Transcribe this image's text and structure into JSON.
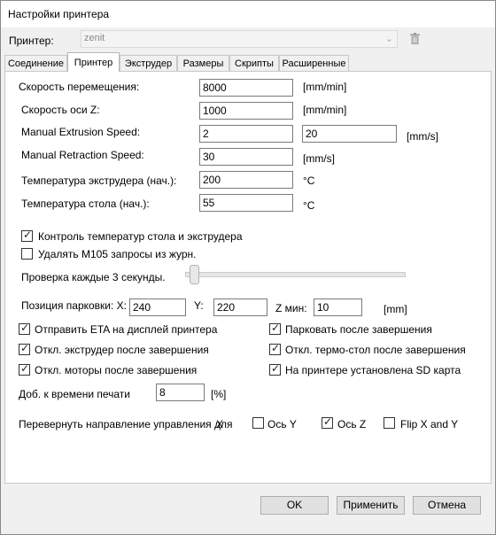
{
  "window": {
    "title": "Настройки принтера"
  },
  "printer": {
    "label": "Принтер:",
    "value": "zenit",
    "delete_icon": "trash-icon"
  },
  "tabs": [
    "Соединение",
    "Принтер",
    "Экструдер",
    "Размеры",
    "Скрипты",
    "Расширенные"
  ],
  "active_tab": "Принтер",
  "speed": {
    "travel_label": "Скорость перемещения:",
    "travel_value": "8000",
    "travel_unit": "[mm/min]",
    "z_label": "Скорость оси Z:",
    "z_value": "1000",
    "z_unit": "[mm/min]",
    "extrusion_label": "Manual Extrusion Speed:",
    "extrusion_value1": "2",
    "extrusion_value2": "20",
    "extrusion_unit": "[mm/s]",
    "retraction_label": "Manual Retraction Speed:",
    "retraction_value": "30",
    "retraction_unit": "[mm/s]"
  },
  "temps": {
    "extruder_label": "Температура экструдера (нач.):",
    "extruder_value": "200",
    "extruder_unit": "°C",
    "bed_label": "Температура стола (нач.):",
    "bed_value": "55",
    "bed_unit": "°C"
  },
  "options": {
    "temp_control": {
      "label": "Контроль температур стола и экструдера",
      "checked": true
    },
    "remove_m105": {
      "label": "Удалять M105 запросы из журн.",
      "checked": false
    }
  },
  "check_interval": {
    "label": "Проверка каждые 3 секунды.",
    "value": 3
  },
  "parking": {
    "label_x": "Позиция парковки: X:",
    "x": "240",
    "label_y": "Y:",
    "y": "220",
    "label_z": "Z мин:",
    "z": "10",
    "unit": "[mm]"
  },
  "checks": {
    "send_eta": {
      "label": "Отправить ETA на дисплей принтера",
      "checked": true
    },
    "park_after": {
      "label": "Парковать после завершения",
      "checked": true
    },
    "disable_extruder": {
      "label": "Откл. экструдер после завершения",
      "checked": true
    },
    "disable_bed": {
      "label": "Откл. термо-стол после завершения",
      "checked": true
    },
    "disable_motors": {
      "label": "Откл. моторы после завершения",
      "checked": true
    },
    "sd_card": {
      "label": "На принтере установлена SD карта",
      "checked": true
    }
  },
  "print_time": {
    "label": "Доб. к времени печати",
    "value": "8",
    "unit": "[%]"
  },
  "invert": {
    "label": "Перевернуть направление управления для",
    "x_label": "X",
    "y": {
      "label": "Ось Y",
      "checked": false
    },
    "z": {
      "label": "Ось Z",
      "checked": true
    },
    "flip_xy": {
      "label": "Flip X and Y",
      "checked": false
    }
  },
  "buttons": {
    "ok": "OK",
    "apply": "Применить",
    "cancel": "Отмена"
  },
  "check_glyph": "✓"
}
